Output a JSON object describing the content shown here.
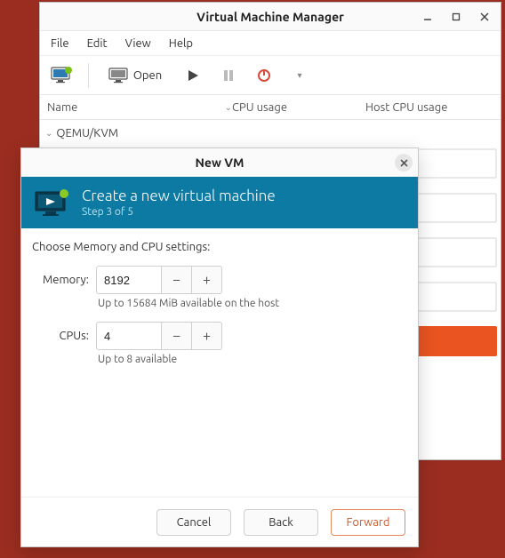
{
  "main_window": {
    "title": "Virtual Machine Manager",
    "menus": {
      "file": "File",
      "edit": "Edit",
      "view": "View",
      "help": "Help"
    },
    "toolbar": {
      "open": "Open"
    },
    "columns": {
      "name": "Name",
      "cpu": "CPU usage",
      "host_cpu": "Host CPU usage"
    },
    "tree": {
      "connection": "QEMU/KVM"
    }
  },
  "dialog": {
    "title": "New VM",
    "header_title": "Create a new virtual machine",
    "header_step": "Step 3 of 5",
    "prompt": "Choose Memory and CPU settings:",
    "memory_label": "Memory:",
    "memory_value": "8192",
    "memory_hint": "Up to 15684 MiB available on the host",
    "cpus_label": "CPUs:",
    "cpus_value": "4",
    "cpus_hint": "Up to 8 available",
    "buttons": {
      "cancel": "Cancel",
      "back": "Back",
      "forward": "Forward"
    }
  }
}
